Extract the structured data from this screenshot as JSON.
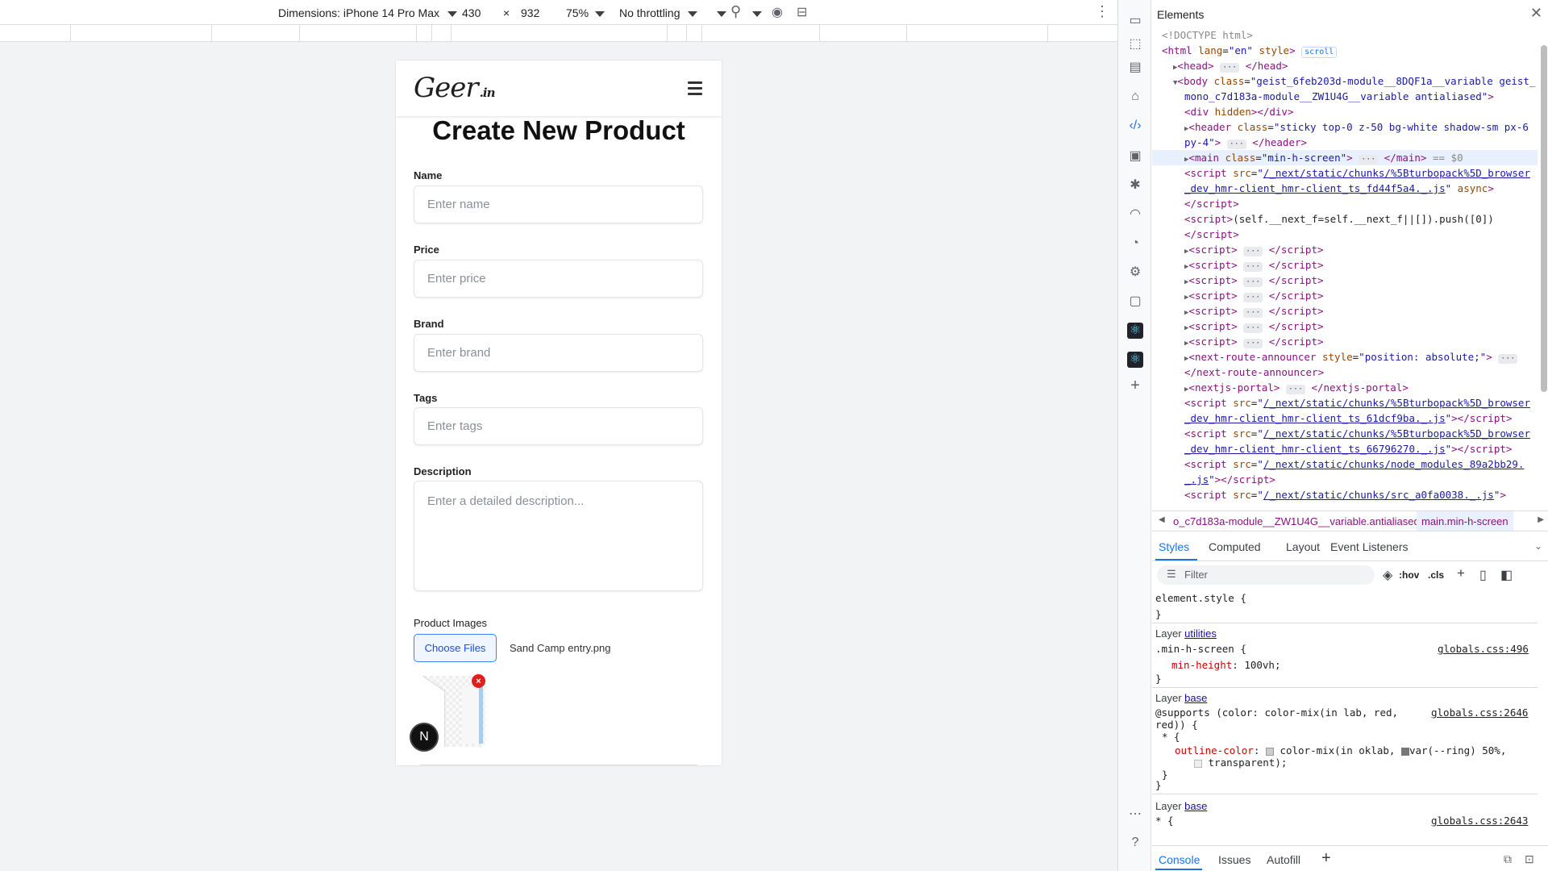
{
  "device_toolbar": {
    "dimensions_label": "Dimensions: iPhone 14 Pro Max",
    "width": "430",
    "times": "×",
    "height": "932",
    "zoom": "75%",
    "throttling": "No throttling"
  },
  "app": {
    "logo_text": "Geer",
    "logo_domain": ".in",
    "page_title": "Create New Product",
    "fields": [
      {
        "label": "Name",
        "placeholder": "Enter name"
      },
      {
        "label": "Price",
        "placeholder": "Enter price"
      },
      {
        "label": "Brand",
        "placeholder": "Enter brand"
      },
      {
        "label": "Tags",
        "placeholder": "Enter tags"
      },
      {
        "label": "Description",
        "placeholder": "Enter a detailed description..."
      }
    ],
    "images_label": "Product Images",
    "choose_files": "Choose Files",
    "file_name": "Sand Camp entry.png",
    "remove_symbol": "×",
    "next_badge": "N"
  },
  "devtools": {
    "panel_title": "Elements",
    "dom_lines": [
      {
        "indent": 0,
        "html": "<span class='cmt'>&lt;!DOCTYPE html&gt;</span>"
      },
      {
        "indent": 0,
        "html": "<span class='tag'>&lt;html</span> <span class='attr'>lang</span>=<span class='val'>\"en\"</span> <span class='attr'>style</span><span class='tag'>&gt;</span> <span class='ell' style='color:#1a73e8;border:1px solid #c6dafc;background:#fff'>scroll</span>"
      },
      {
        "indent": 1,
        "html": "<span class='arrow'>▶</span><span class='tag'>&lt;head&gt;</span> <span class='ell'>···</span> <span class='tag'>&lt;/head&gt;</span>"
      },
      {
        "indent": 1,
        "html": "<span class='arrow'>▼</span><span class='tag'>&lt;body</span> <span class='attr'>class</span>=<span class='val'>\"geist_6feb203d-module__8DQF1a__variable geist_</span>"
      },
      {
        "indent": 2,
        "html": "<span class='val'>mono_c7d183a-module__ZW1U4G__variable antialiased\"</span><span class='tag'>&gt;</span>"
      },
      {
        "indent": 2,
        "html": "<span class='tag'>&lt;div</span> <span class='attr'>hidden</span><span class='tag'>&gt;&lt;/div&gt;</span>"
      },
      {
        "indent": 2,
        "html": "<span class='arrow'>▶</span><span class='tag'>&lt;header</span> <span class='attr'>class</span>=<span class='val'>\"sticky top-0 z-50 bg-white shadow-sm px-6</span>"
      },
      {
        "indent": 2,
        "html": "<span class='val'>py-4\"</span><span class='tag'>&gt;</span> <span class='ell'>···</span> <span class='tag'>&lt;/header&gt;</span>"
      },
      {
        "indent": 2,
        "sel": true,
        "html": "<span class='arrow'>▶</span><span class='tag'>&lt;main</span> <span class='attr'>class</span>=<span class='val'>\"min-h-screen\"</span><span class='tag'>&gt;</span> <span class='ell'>···</span> <span class='tag'>&lt;/main&gt;</span> <span class='cmt'>== $0</span>"
      },
      {
        "indent": 2,
        "html": "<span class='tag'>&lt;script</span> <span class='attr'>src</span>=<span class='val'>\"</span><span class='link'>/_next/static/chunks/%5Bturbopack%5D_browser</span>"
      },
      {
        "indent": 2,
        "html": "<span class='link'>_dev_hmr-client_hmr-client_ts_fd44f5a4._.js</span><span class='val'>\"</span> <span class='attr'>async</span><span class='tag'>&gt;</span>"
      },
      {
        "indent": 2,
        "html": "<span class='tag'>&lt;/script&gt;</span>"
      },
      {
        "indent": 2,
        "html": "<span class='tag'>&lt;script&gt;</span>(self.__next_f=self.__next_f||[]).push([0])"
      },
      {
        "indent": 2,
        "html": "<span class='tag'>&lt;/script&gt;</span>"
      },
      {
        "indent": 2,
        "html": "<span class='arrow'>▶</span><span class='tag'>&lt;script&gt;</span> <span class='ell'>···</span> <span class='tag'>&lt;/script&gt;</span>"
      },
      {
        "indent": 2,
        "html": "<span class='arrow'>▶</span><span class='tag'>&lt;script&gt;</span> <span class='ell'>···</span> <span class='tag'>&lt;/script&gt;</span>"
      },
      {
        "indent": 2,
        "html": "<span class='arrow'>▶</span><span class='tag'>&lt;script&gt;</span> <span class='ell'>···</span> <span class='tag'>&lt;/script&gt;</span>"
      },
      {
        "indent": 2,
        "html": "<span class='arrow'>▶</span><span class='tag'>&lt;script&gt;</span> <span class='ell'>···</span> <span class='tag'>&lt;/script&gt;</span>"
      },
      {
        "indent": 2,
        "html": "<span class='arrow'>▶</span><span class='tag'>&lt;script&gt;</span> <span class='ell'>···</span> <span class='tag'>&lt;/script&gt;</span>"
      },
      {
        "indent": 2,
        "html": "<span class='arrow'>▶</span><span class='tag'>&lt;script&gt;</span> <span class='ell'>···</span> <span class='tag'>&lt;/script&gt;</span>"
      },
      {
        "indent": 2,
        "html": "<span class='arrow'>▶</span><span class='tag'>&lt;script&gt;</span> <span class='ell'>···</span> <span class='tag'>&lt;/script&gt;</span>"
      },
      {
        "indent": 2,
        "html": "<span class='arrow'>▶</span><span class='tag'>&lt;next-route-announcer</span> <span class='attr'>style</span>=<span class='val'>\"position: absolute;\"</span><span class='tag'>&gt;</span> <span class='ell'>···</span>"
      },
      {
        "indent": 2,
        "html": "<span class='tag'>&lt;/next-route-announcer&gt;</span>"
      },
      {
        "indent": 2,
        "html": "<span class='arrow'>▶</span><span class='tag'>&lt;nextjs-portal&gt;</span> <span class='ell'>···</span> <span class='tag'>&lt;/nextjs-portal&gt;</span>"
      },
      {
        "indent": 2,
        "html": "<span class='tag'>&lt;script</span> <span class='attr'>src</span>=<span class='val'>\"</span><span class='link'>/_next/static/chunks/%5Bturbopack%5D_browser</span>"
      },
      {
        "indent": 2,
        "html": "<span class='link'>_dev_hmr-client_hmr-client_ts_61dcf9ba._.js</span><span class='val'>\"</span><span class='tag'>&gt;&lt;/script&gt;</span>"
      },
      {
        "indent": 2,
        "html": "<span class='tag'>&lt;script</span> <span class='attr'>src</span>=<span class='val'>\"</span><span class='link'>/_next/static/chunks/%5Bturbopack%5D_browser</span>"
      },
      {
        "indent": 2,
        "html": "<span class='link'>_dev_hmr-client_hmr-client_ts_66796270._.js</span><span class='val'>\"</span><span class='tag'>&gt;&lt;/script&gt;</span>"
      },
      {
        "indent": 2,
        "html": "<span class='tag'>&lt;script</span> <span class='attr'>src</span>=<span class='val'>\"</span><span class='link'>/_next/static/chunks/node_modules_89a2bb29.</span>"
      },
      {
        "indent": 2,
        "html": "<span class='link'>_.js</span><span class='val'>\"</span><span class='tag'>&gt;&lt;/script&gt;</span>"
      },
      {
        "indent": 2,
        "html": "<span class='tag'>&lt;script</span> <span class='attr'>src</span>=<span class='val'>\"</span><span class='link'>/_next/static/chunks/src_a0fa0038._.js</span><span class='val'>\"</span><span class='tag'>&gt;</span>"
      }
    ],
    "breadcrumb_1": "o_c7d183a-module__ZW1U4G__variable.antialiased",
    "breadcrumb_2": "main.min-h-screen",
    "styles_tabs": [
      "Styles",
      "Computed",
      "Layout",
      "Event Listeners"
    ],
    "filter_placeholder": "Filter",
    "hov": ":hov",
    "cls": ".cls",
    "element_style": "element.style {",
    "close_brace": "}",
    "layer_label": "Layer",
    "layer_utilities": "utilities",
    "layer_base": "base",
    "min_h_selector": ".min-h-screen {",
    "min_h_source": "globals.css:496",
    "min_h_prop": "min-height",
    "min_h_value": "100vh;",
    "supports_line1": "@supports (color: color-mix(in lab, red,",
    "supports_line2": "red)) {",
    "supports_source": "globals.css:2646",
    "star_open": "* {",
    "outline_prop": "outline-color",
    "outline_value": "color-mix(in oklab, ",
    "outline_value2": "var(--ring) 50%,",
    "outline_value3": "transparent);",
    "base2_source": "globals.css:2643",
    "console_tabs": [
      "Console",
      "Issues",
      "Autofill"
    ],
    "add_tab": "+"
  }
}
